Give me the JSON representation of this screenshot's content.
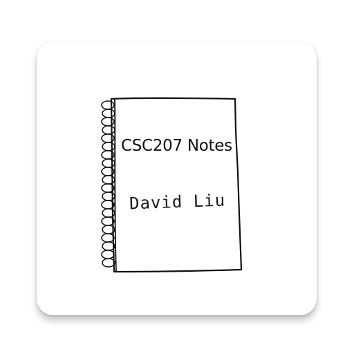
{
  "app_icon": {
    "notebook": {
      "title": "CSC207 Notes",
      "author": "David Liu"
    },
    "colors": {
      "background": "#ffffff",
      "ink": "#111111"
    },
    "icons": {
      "spiral": "spiral-binding-icon",
      "page": "notebook-page-icon"
    }
  }
}
